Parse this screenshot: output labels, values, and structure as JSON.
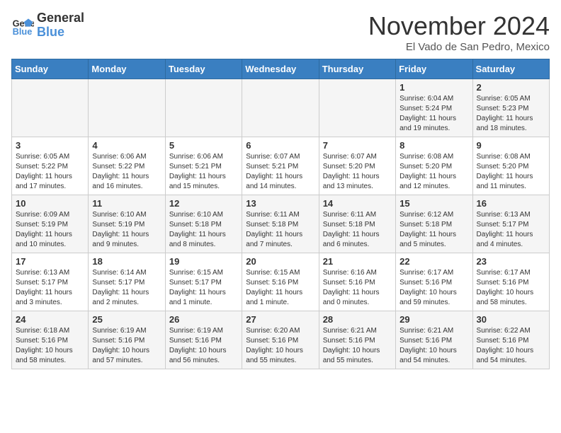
{
  "header": {
    "logo_general": "General",
    "logo_blue": "Blue",
    "month": "November 2024",
    "location": "El Vado de San Pedro, Mexico"
  },
  "weekdays": [
    "Sunday",
    "Monday",
    "Tuesday",
    "Wednesday",
    "Thursday",
    "Friday",
    "Saturday"
  ],
  "weeks": [
    [
      {
        "day": "",
        "info": ""
      },
      {
        "day": "",
        "info": ""
      },
      {
        "day": "",
        "info": ""
      },
      {
        "day": "",
        "info": ""
      },
      {
        "day": "",
        "info": ""
      },
      {
        "day": "1",
        "info": "Sunrise: 6:04 AM\nSunset: 5:24 PM\nDaylight: 11 hours and 19 minutes."
      },
      {
        "day": "2",
        "info": "Sunrise: 6:05 AM\nSunset: 5:23 PM\nDaylight: 11 hours and 18 minutes."
      }
    ],
    [
      {
        "day": "3",
        "info": "Sunrise: 6:05 AM\nSunset: 5:22 PM\nDaylight: 11 hours and 17 minutes."
      },
      {
        "day": "4",
        "info": "Sunrise: 6:06 AM\nSunset: 5:22 PM\nDaylight: 11 hours and 16 minutes."
      },
      {
        "day": "5",
        "info": "Sunrise: 6:06 AM\nSunset: 5:21 PM\nDaylight: 11 hours and 15 minutes."
      },
      {
        "day": "6",
        "info": "Sunrise: 6:07 AM\nSunset: 5:21 PM\nDaylight: 11 hours and 14 minutes."
      },
      {
        "day": "7",
        "info": "Sunrise: 6:07 AM\nSunset: 5:20 PM\nDaylight: 11 hours and 13 minutes."
      },
      {
        "day": "8",
        "info": "Sunrise: 6:08 AM\nSunset: 5:20 PM\nDaylight: 11 hours and 12 minutes."
      },
      {
        "day": "9",
        "info": "Sunrise: 6:08 AM\nSunset: 5:20 PM\nDaylight: 11 hours and 11 minutes."
      }
    ],
    [
      {
        "day": "10",
        "info": "Sunrise: 6:09 AM\nSunset: 5:19 PM\nDaylight: 11 hours and 10 minutes."
      },
      {
        "day": "11",
        "info": "Sunrise: 6:10 AM\nSunset: 5:19 PM\nDaylight: 11 hours and 9 minutes."
      },
      {
        "day": "12",
        "info": "Sunrise: 6:10 AM\nSunset: 5:18 PM\nDaylight: 11 hours and 8 minutes."
      },
      {
        "day": "13",
        "info": "Sunrise: 6:11 AM\nSunset: 5:18 PM\nDaylight: 11 hours and 7 minutes."
      },
      {
        "day": "14",
        "info": "Sunrise: 6:11 AM\nSunset: 5:18 PM\nDaylight: 11 hours and 6 minutes."
      },
      {
        "day": "15",
        "info": "Sunrise: 6:12 AM\nSunset: 5:18 PM\nDaylight: 11 hours and 5 minutes."
      },
      {
        "day": "16",
        "info": "Sunrise: 6:13 AM\nSunset: 5:17 PM\nDaylight: 11 hours and 4 minutes."
      }
    ],
    [
      {
        "day": "17",
        "info": "Sunrise: 6:13 AM\nSunset: 5:17 PM\nDaylight: 11 hours and 3 minutes."
      },
      {
        "day": "18",
        "info": "Sunrise: 6:14 AM\nSunset: 5:17 PM\nDaylight: 11 hours and 2 minutes."
      },
      {
        "day": "19",
        "info": "Sunrise: 6:15 AM\nSunset: 5:17 PM\nDaylight: 11 hours and 1 minute."
      },
      {
        "day": "20",
        "info": "Sunrise: 6:15 AM\nSunset: 5:16 PM\nDaylight: 11 hours and 1 minute."
      },
      {
        "day": "21",
        "info": "Sunrise: 6:16 AM\nSunset: 5:16 PM\nDaylight: 11 hours and 0 minutes."
      },
      {
        "day": "22",
        "info": "Sunrise: 6:17 AM\nSunset: 5:16 PM\nDaylight: 10 hours and 59 minutes."
      },
      {
        "day": "23",
        "info": "Sunrise: 6:17 AM\nSunset: 5:16 PM\nDaylight: 10 hours and 58 minutes."
      }
    ],
    [
      {
        "day": "24",
        "info": "Sunrise: 6:18 AM\nSunset: 5:16 PM\nDaylight: 10 hours and 58 minutes."
      },
      {
        "day": "25",
        "info": "Sunrise: 6:19 AM\nSunset: 5:16 PM\nDaylight: 10 hours and 57 minutes."
      },
      {
        "day": "26",
        "info": "Sunrise: 6:19 AM\nSunset: 5:16 PM\nDaylight: 10 hours and 56 minutes."
      },
      {
        "day": "27",
        "info": "Sunrise: 6:20 AM\nSunset: 5:16 PM\nDaylight: 10 hours and 55 minutes."
      },
      {
        "day": "28",
        "info": "Sunrise: 6:21 AM\nSunset: 5:16 PM\nDaylight: 10 hours and 55 minutes."
      },
      {
        "day": "29",
        "info": "Sunrise: 6:21 AM\nSunset: 5:16 PM\nDaylight: 10 hours and 54 minutes."
      },
      {
        "day": "30",
        "info": "Sunrise: 6:22 AM\nSunset: 5:16 PM\nDaylight: 10 hours and 54 minutes."
      }
    ]
  ]
}
